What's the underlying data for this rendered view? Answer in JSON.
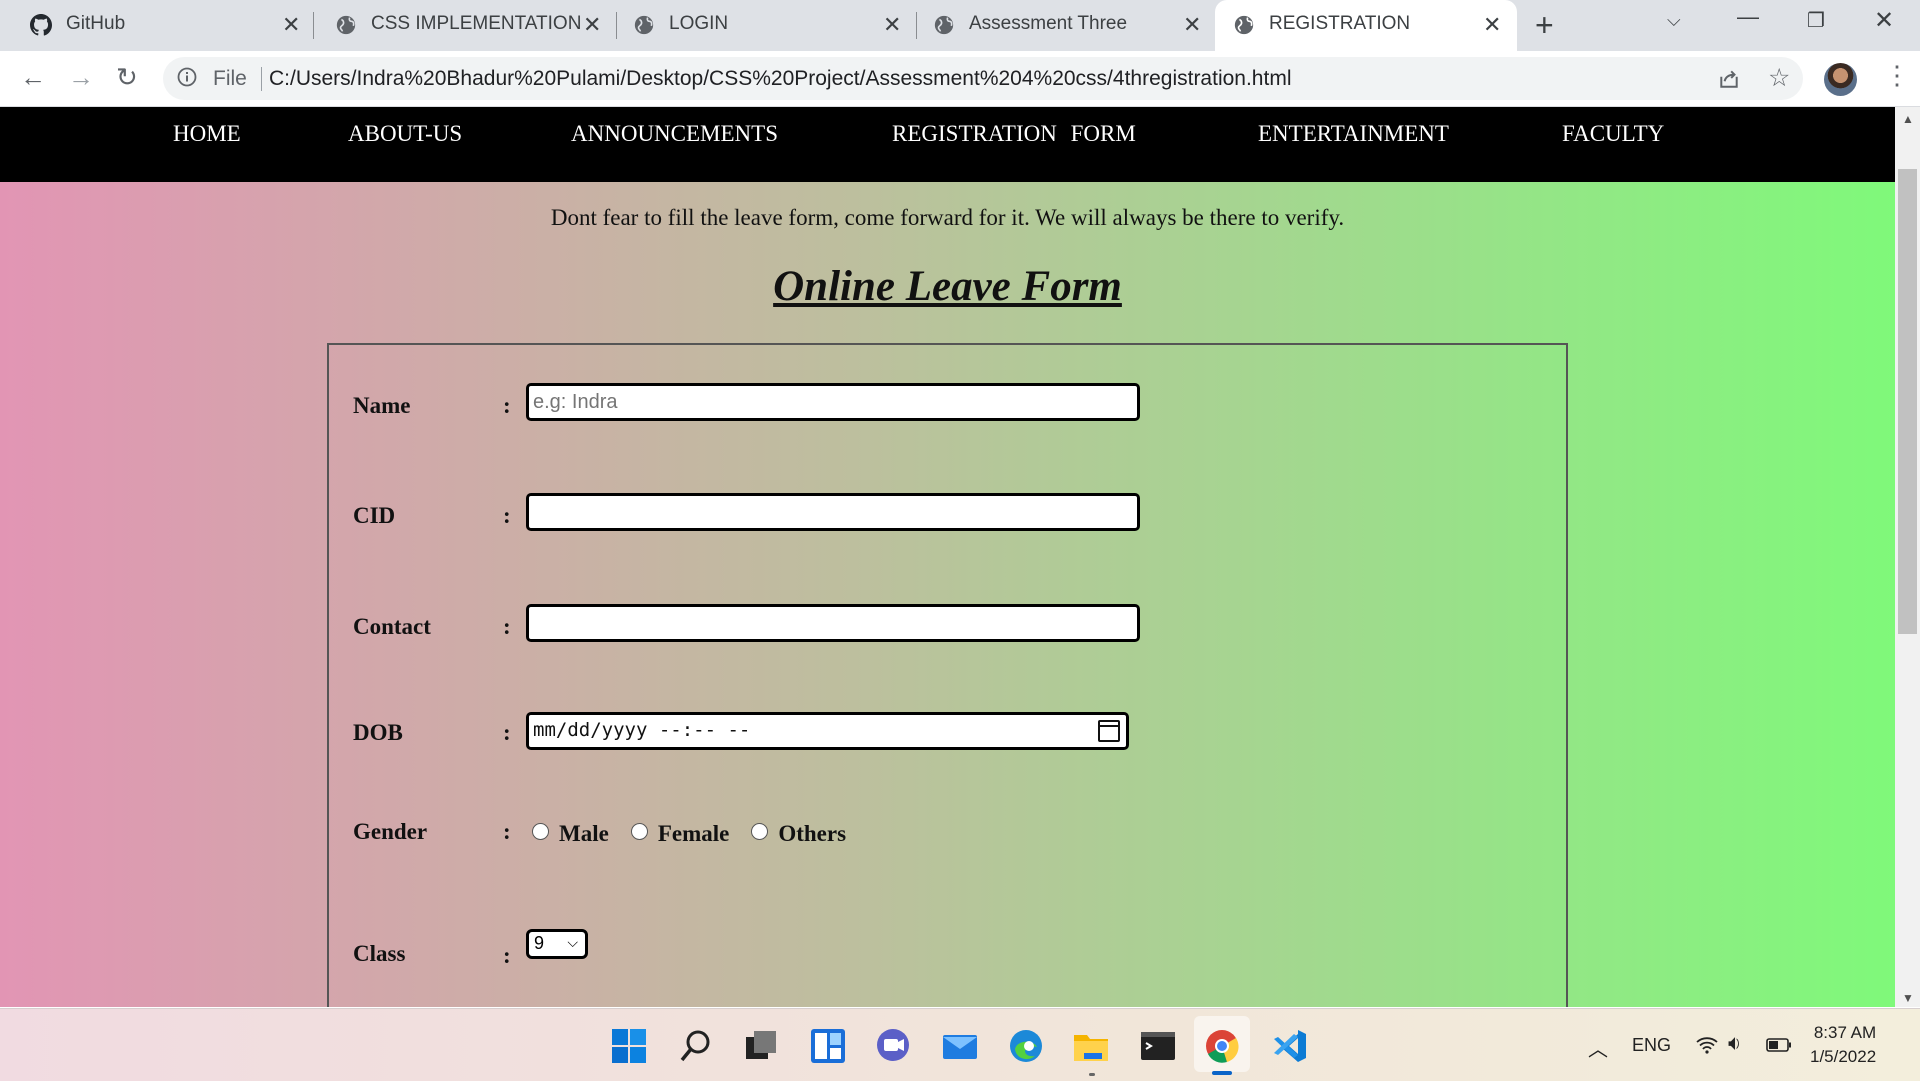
{
  "browser": {
    "tabs": [
      {
        "title": "GitHub",
        "icon": "github-icon"
      },
      {
        "title": "CSS IMPLEMENTATION",
        "icon": "globe-icon"
      },
      {
        "title": "LOGIN",
        "icon": "globe-icon"
      },
      {
        "title": "Assessment Three",
        "icon": "globe-icon"
      },
      {
        "title": "REGISTRATION",
        "icon": "globe-icon",
        "active": true
      }
    ],
    "address": {
      "scheme": "File",
      "url": "C:/Users/Indra%20Bhadur%20Pulami/Desktop/CSS%20Project/Assessment%204%20css/4thregistration.html"
    }
  },
  "nav": {
    "home": "HOME",
    "about": "ABOUT-US",
    "announcements": "ANNOUNCEMENTS",
    "registration": "REGISTRATION FORM",
    "entertainment": "ENTERTAINMENT",
    "faculty": "FACULTY"
  },
  "page": {
    "intro": "Dont fear to fill the leave form, come forward for it. We will always be there to verify.",
    "title": "Online Leave Form"
  },
  "form": {
    "name_label": "Name",
    "name_placeholder": "e.g: Indra",
    "cid_label": "CID",
    "contact_label": "Contact",
    "dob_label": "DOB",
    "dob_value": "mm/dd/yyyy --:-- --",
    "gender_label": "Gender",
    "gender_options": [
      "Male",
      "Female",
      "Others"
    ],
    "class_label": "Class",
    "class_value": "9",
    "colon": ":"
  },
  "taskbar": {
    "apps": [
      "windows-start-icon",
      "search-icon",
      "task-view-icon",
      "widgets-icon",
      "chat-icon",
      "mail-icon",
      "edge-icon",
      "file-explorer-icon",
      "terminal-icon",
      "chrome-icon",
      "vscode-icon"
    ],
    "language": "ENG",
    "time": "8:37 AM",
    "date": "1/5/2022"
  },
  "colors": {
    "gradient_left": "#e295b4",
    "gradient_right": "#7ff97a",
    "nav_bg": "#000000"
  }
}
